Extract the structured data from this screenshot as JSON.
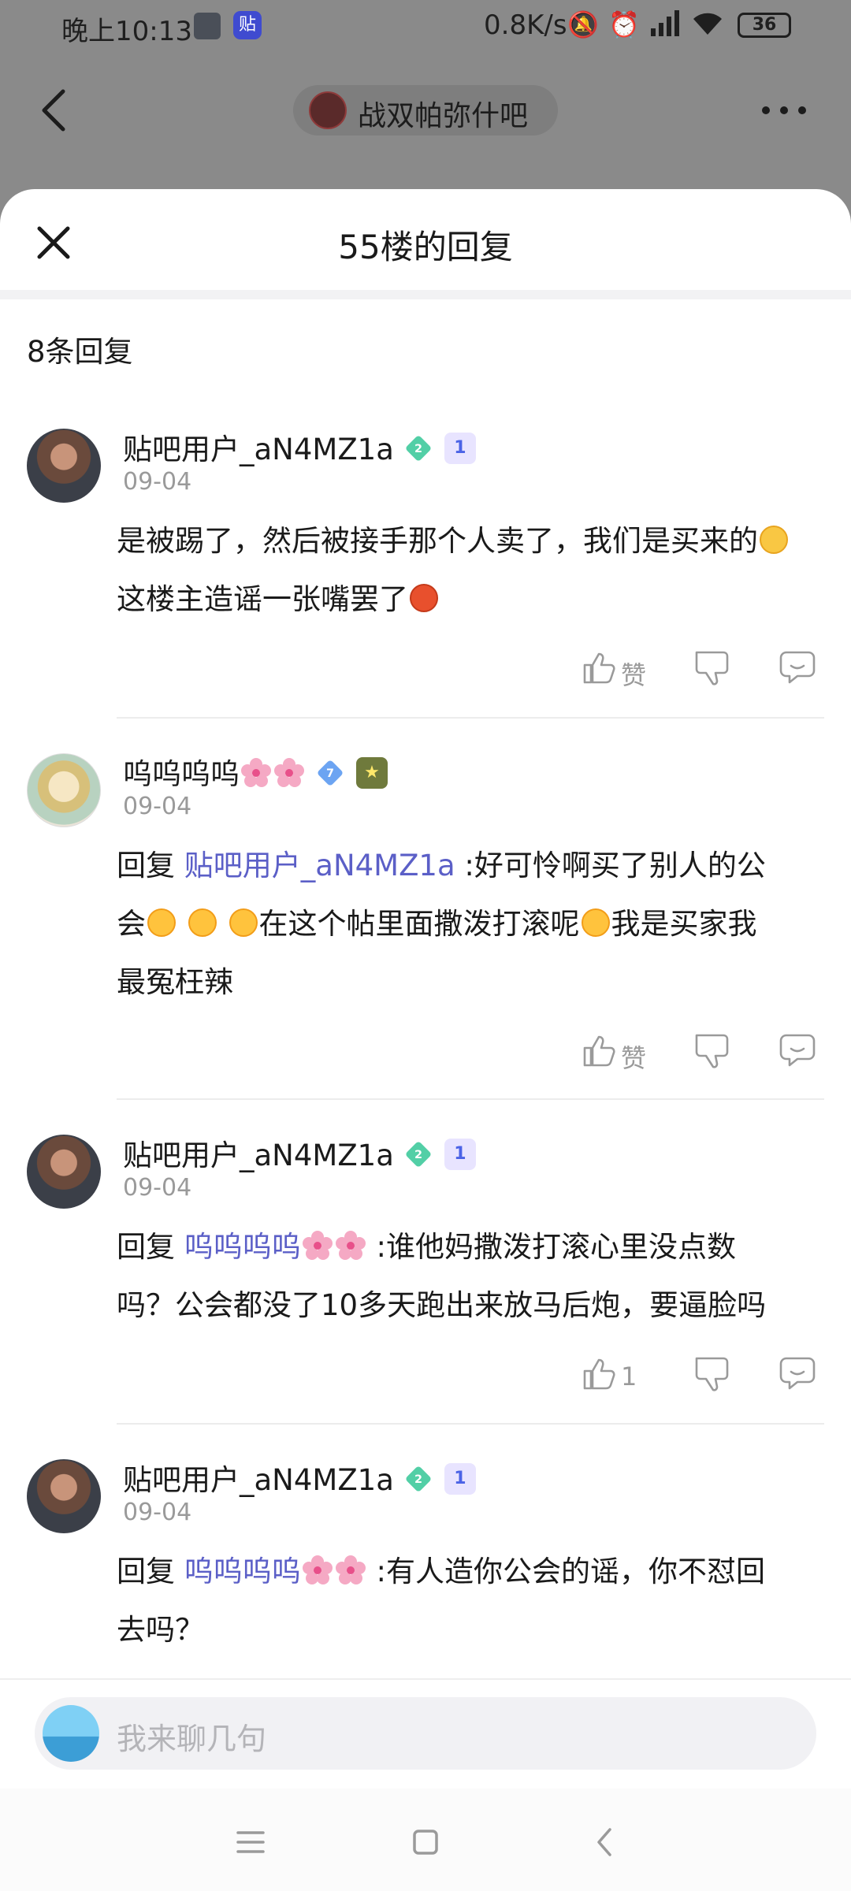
{
  "status_bar": {
    "time": "晚上10:13",
    "app_icon_label": "贴",
    "speed": "0.8K/s",
    "battery": "36",
    "icons": [
      "mute-icon",
      "alarm-icon",
      "signal-icon",
      "wifi-icon"
    ]
  },
  "top_nav": {
    "forum_name": "战双帕弥什吧"
  },
  "sheet": {
    "title": "55楼的回复",
    "reply_count": "8条回复"
  },
  "replies": [
    {
      "username": "贴吧用户_aN4MZ1a",
      "level": "2",
      "rank": "1",
      "date": "09-04",
      "line1": "是被踢了，然后被接手那个人卖了，我们是买来的",
      "line2": "这楼主造谣一张嘴罢了",
      "like_label": "赞"
    },
    {
      "username": "呜呜呜呜",
      "level": "7",
      "rank": "★",
      "date": "09-04",
      "reply_prefix": "回复 ",
      "mention": "贴吧用户_aN4MZ1a",
      "text1": " :好可怜啊买了别人的公",
      "text2a": "会",
      "text2b": "在这个帖里面撒泼打滚呢",
      "text2c": "我是买家我",
      "text3": "最冤枉辣",
      "like_label": "赞"
    },
    {
      "username": "贴吧用户_aN4MZ1a",
      "level": "2",
      "rank": "1",
      "date": "09-04",
      "reply_prefix": "回复 ",
      "mention": "呜呜呜呜",
      "text1": " :谁他妈撒泼打滚心里没点数",
      "text2": "吗？公会都没了10多天跑出来放马后炮，要逼脸吗",
      "like_label": "1"
    },
    {
      "username": "贴吧用户_aN4MZ1a",
      "level": "2",
      "rank": "1",
      "date": "09-04",
      "reply_prefix": "回复 ",
      "mention": "呜呜呜呜",
      "text1": " :有人造你公会的谣，你不怼回",
      "text2": "去吗？"
    }
  ],
  "input": {
    "placeholder": "我来聊几句"
  },
  "colors": {
    "mention": "#5b5fc7",
    "muted": "#9a9a9a",
    "overlay": "#8a8a8a"
  }
}
